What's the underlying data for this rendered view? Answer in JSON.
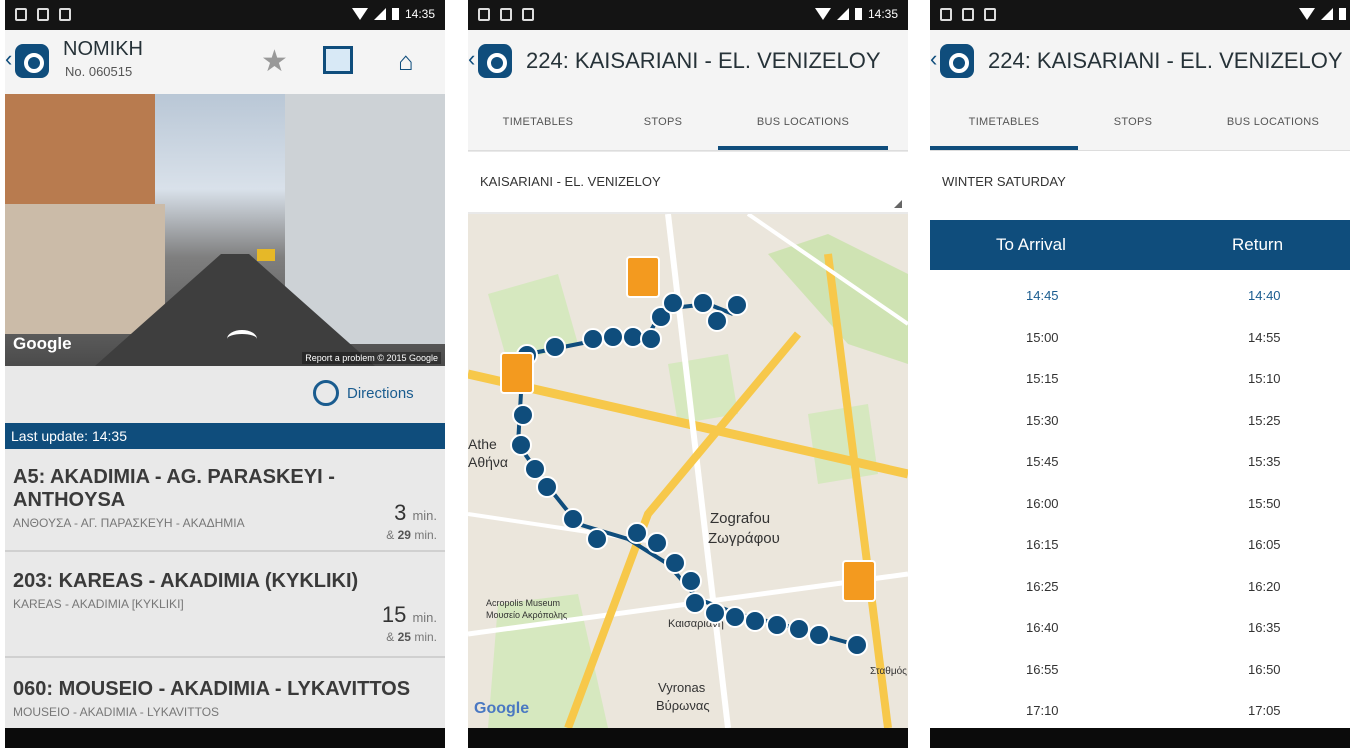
{
  "status_bar": {
    "time": "14:35"
  },
  "screen1": {
    "stop_name": "NOMIKH",
    "stop_number": "No. 060515",
    "street_view": {
      "watermark": "Google",
      "report": "Report a problem",
      "copyright": "© 2015 Google"
    },
    "directions_label": "Directions",
    "last_update": "Last update: 14:35",
    "arrivals": [
      {
        "route": "A5: AKADIMIA - AG. PARASKEYI - ANTHOYSA",
        "greek": "ΑΝΘΟΥΣΑ - ΑΓ. ΠΑΡΑΣΚΕΥΗ - ΑΚΑΔΗΜΙΑ",
        "minutes": "3",
        "unit": "min.",
        "next_prefix": "& ",
        "next_minutes": "29",
        "next_unit": " min."
      },
      {
        "route": "203: KAREAS - AKADIMIA (KYKLIKI)",
        "greek": "KAREAS - AKADIMIA [KYKLIKI]",
        "minutes": "15",
        "unit": "min.",
        "next_prefix": "& ",
        "next_minutes": "25",
        "next_unit": " min."
      },
      {
        "route": "060: MOUSEIO - AKADIMIA - LYKAVITTOS",
        "greek": "MOUSEIO - AKADIMIA - LYKAVITTOS"
      }
    ]
  },
  "screen2": {
    "title": "224: KAISARIANI - EL. VENIZELOY",
    "tabs": [
      "TIMETABLES",
      "STOPS",
      "BUS LOCATIONS"
    ],
    "active_tab": "BUS LOCATIONS",
    "direction": "KAISARIANI - EL. VENIZELOY",
    "map_labels": {
      "zografou": "Zografou",
      "zografou_gr": "Ζωγράφου",
      "athens": "Athe",
      "athens_gr": "Αθήνα",
      "vyronas": "Vyronas",
      "vyronas_gr": "Βύρωνας",
      "acropolis": "Acropolis Museum",
      "acropolis_gr": "Μουσείο Ακρόπολης",
      "kaisariani": "Καισαριανή",
      "stathmos": "Σταθμός",
      "watermark": "Google"
    }
  },
  "screen3": {
    "title": "224: KAISARIANI - EL. VENIZELOY",
    "tabs": [
      "TIMETABLES",
      "STOPS",
      "BUS LOCATIONS"
    ],
    "active_tab": "TIMETABLES",
    "schedule": "WINTER SATURDAY",
    "headers": {
      "arrival": "To Arrival",
      "return": "Return"
    },
    "rows": [
      [
        "14:45",
        "14:40"
      ],
      [
        "15:00",
        "14:55"
      ],
      [
        "15:15",
        "15:10"
      ],
      [
        "15:30",
        "15:25"
      ],
      [
        "15:45",
        "15:35"
      ],
      [
        "16:00",
        "15:50"
      ],
      [
        "16:15",
        "16:05"
      ],
      [
        "16:25",
        "16:20"
      ],
      [
        "16:40",
        "16:35"
      ],
      [
        "16:55",
        "16:50"
      ],
      [
        "17:10",
        "17:05"
      ]
    ]
  },
  "colors": {
    "brand": "#0f4d7c",
    "bus": "#f39a1f"
  }
}
